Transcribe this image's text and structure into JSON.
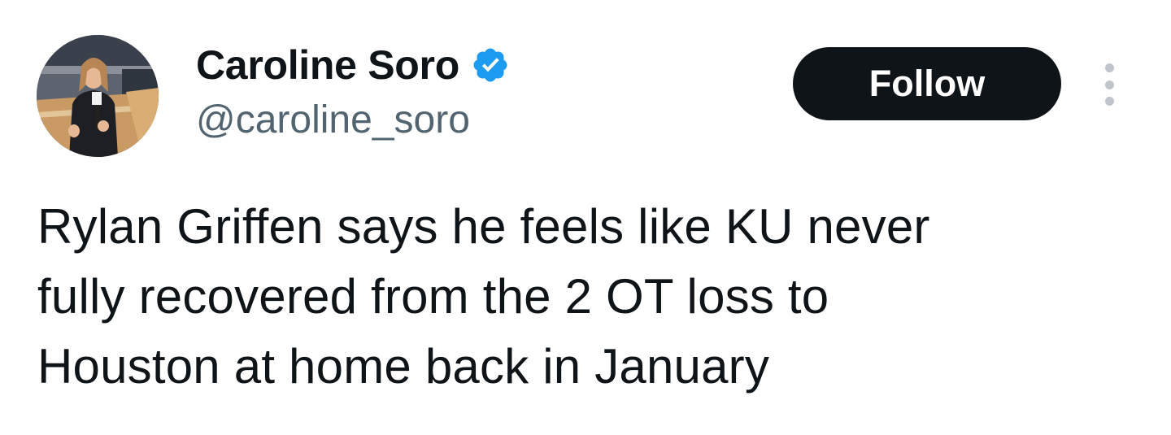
{
  "author": {
    "display_name": "Caroline Soro",
    "handle": "@caroline_soro",
    "verified": true,
    "avatar_icon": "profile-photo"
  },
  "actions": {
    "follow_label": "Follow",
    "more_icon": "more-vertical-icon"
  },
  "tweet": {
    "text": "Rylan Griffen says he feels like KU never\nfully recovered from the 2 OT loss to\nHouston at home back in January"
  },
  "colors": {
    "text_primary": "#0f1419",
    "text_secondary": "#536471",
    "verified_blue": "#1d9bf0",
    "button_bg": "#0f1419",
    "button_text": "#ffffff"
  }
}
